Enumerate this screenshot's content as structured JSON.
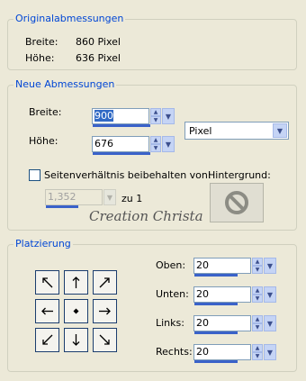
{
  "original": {
    "legend": "Originalabmessungen",
    "width_label": "Breite:",
    "width_value": "860 Pixel",
    "height_label": "Höhe:",
    "height_value": "636 Pixel"
  },
  "new_dims": {
    "legend": "Neue Abmessungen",
    "width_label": "Breite:",
    "width_value": "900",
    "height_label": "Höhe:",
    "height_value": "676",
    "unit_selected": "Pixel",
    "aspect_label": "Seitenverhältnis beibehalten von:",
    "aspect_checked": false,
    "ratio_value": "1,352",
    "ratio_suffix": "zu 1",
    "background_label": "Hintergrund:",
    "watermark": "Creation Christa"
  },
  "placement": {
    "legend": "Platzierung",
    "top_label": "Oben:",
    "top_value": "20",
    "bottom_label": "Unten:",
    "bottom_value": "20",
    "left_label": "Links:",
    "left_value": "20",
    "right_label": "Rechts:",
    "right_value": "20"
  },
  "colors": {
    "accent": "#0046d5",
    "bar": "#3a62c9"
  }
}
